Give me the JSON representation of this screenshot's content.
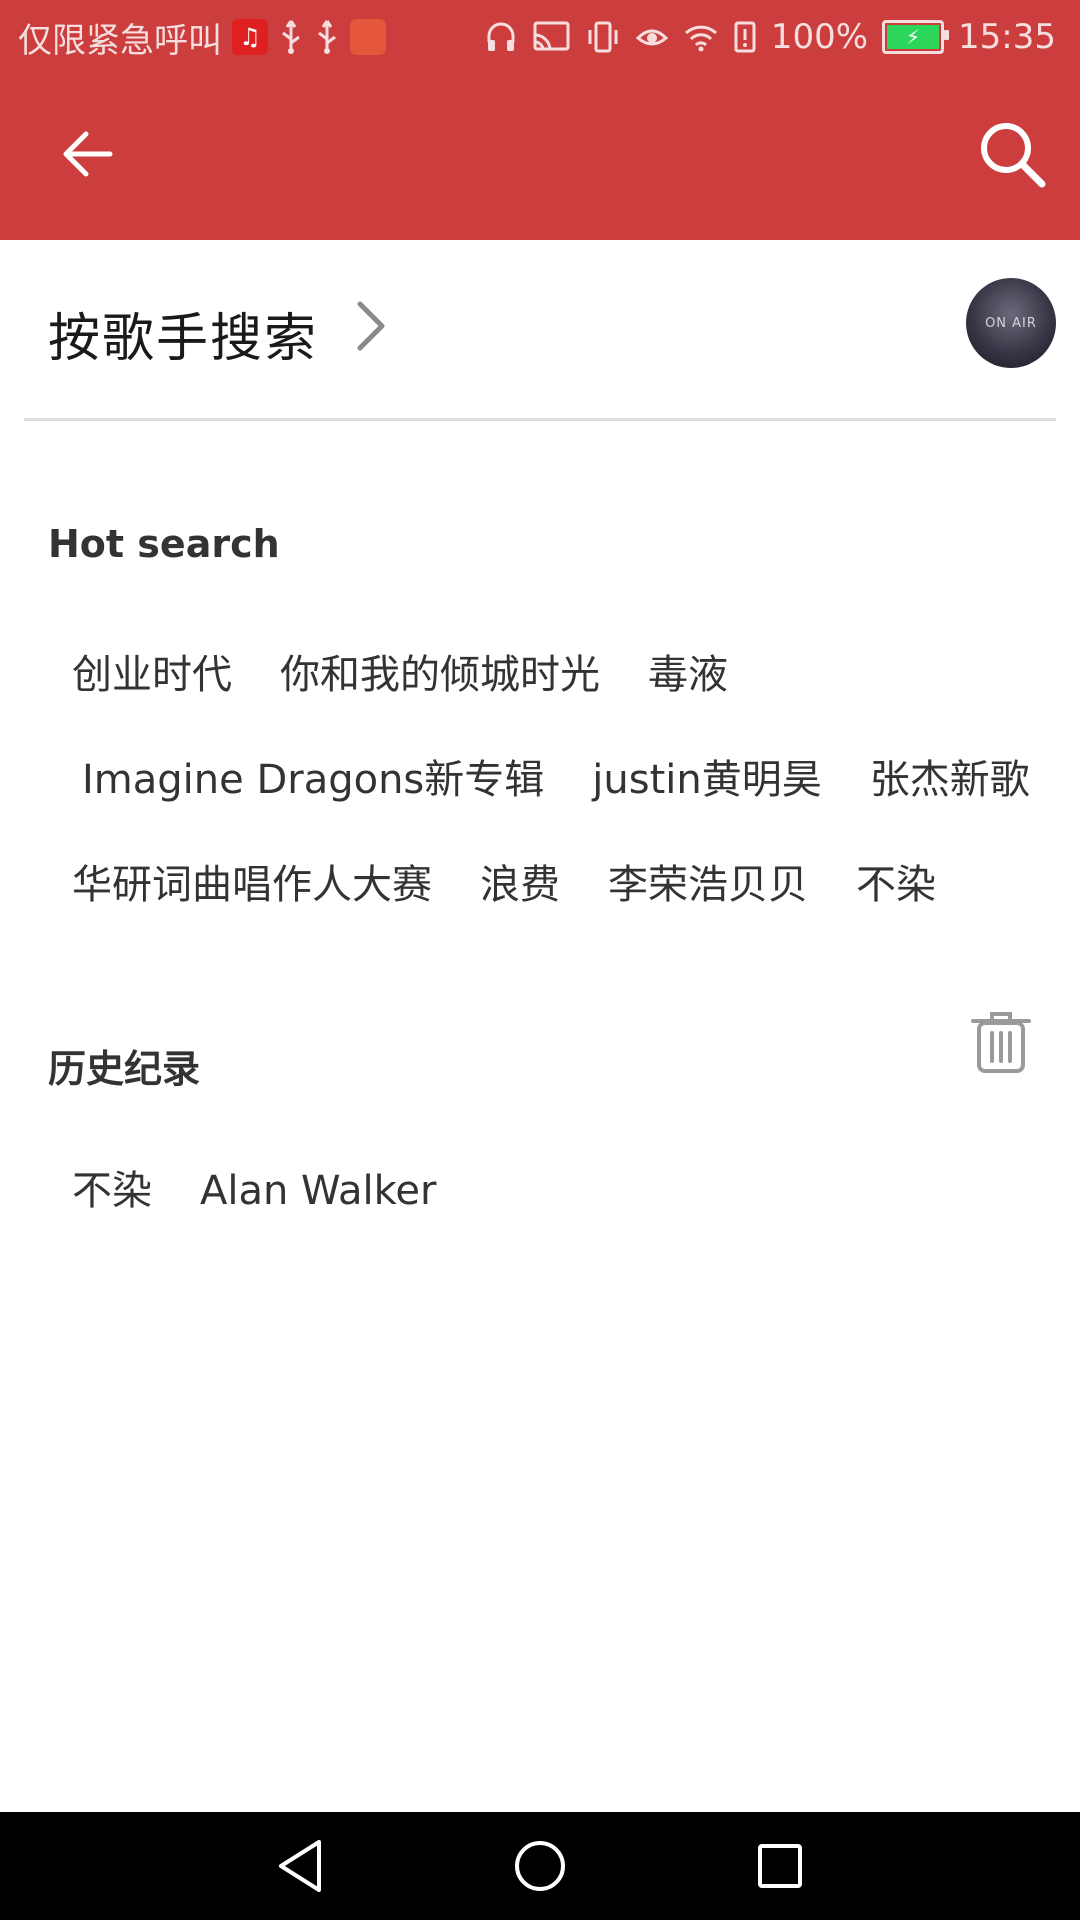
{
  "status_bar": {
    "carrier_text": "仅限紧急呼叫",
    "battery_percent": "100%",
    "time": "15:35"
  },
  "singer_search": {
    "label": "按歌手搜索",
    "avatar_text": "ON AIR"
  },
  "hot_search": {
    "title": "Hot search",
    "rows": [
      [
        "创业时代",
        "你和我的倾城时光",
        "毒液"
      ],
      [
        "Imagine Dragons新专辑",
        "justin黄明昊",
        "张杰新歌"
      ],
      [
        "华研词曲唱作人大赛",
        "浪费",
        "李荣浩贝贝",
        "不染"
      ]
    ]
  },
  "history": {
    "title": "历史纪录",
    "items": [
      "不染",
      "Alan Walker"
    ]
  },
  "colors": {
    "toolbar": "#cc3d3d",
    "navbar": "#000000"
  }
}
